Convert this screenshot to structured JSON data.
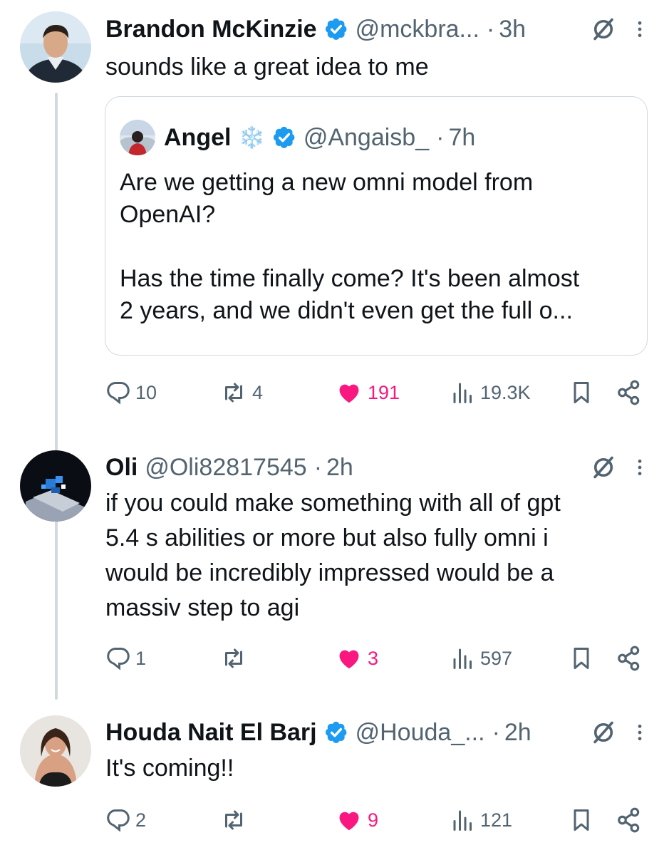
{
  "colors": {
    "text": "#0f1419",
    "secondary": "#536471",
    "verified": "#1d9bf0",
    "like": "#f91880",
    "border": "#cfd9de"
  },
  "posts": [
    {
      "name": "Brandon McKinzie",
      "verified": true,
      "handle": "@mckbra...",
      "separator": "·",
      "time": "3h",
      "text": "sounds like a great idea to me",
      "quote": {
        "name": "Angel",
        "name_emoji": "❄️",
        "verified": true,
        "handle": "@Angaisb_",
        "separator": "·",
        "time": "7h",
        "text": "Are we getting a new omni model from\nOpenAI?\n\nHas the time finally come? It's been almost\n2 years, and we didn't even get the full o..."
      },
      "stats": {
        "replies": "10",
        "reposts": "4",
        "likes": "191",
        "views": "19.3K"
      },
      "liked": true
    },
    {
      "name": "Oli",
      "verified": false,
      "handle": "@Oli82817545",
      "separator": "·",
      "time": "2h",
      "text": "if you could make something with all of gpt\n5.4 s abilities or more but also fully omni i\nwould be incredibly impressed would be a\nmassiv step to agi",
      "stats": {
        "replies": "1",
        "reposts": "",
        "likes": "3",
        "views": "597"
      },
      "liked": true
    },
    {
      "name": "Houda Nait El Barj",
      "verified": true,
      "handle": "@Houda_...",
      "separator": "·",
      "time": "2h",
      "text": "It's coming!!",
      "stats": {
        "replies": "2",
        "reposts": "",
        "likes": "9",
        "views": "121"
      },
      "liked": true
    }
  ],
  "icons": {
    "verified": "verified-badge-icon",
    "grok": "grok-icon",
    "more": "more-icon",
    "reply": "reply-icon",
    "repost": "repost-icon",
    "like": "heart-icon",
    "views": "views-icon",
    "bookmark": "bookmark-icon",
    "share": "share-icon"
  }
}
